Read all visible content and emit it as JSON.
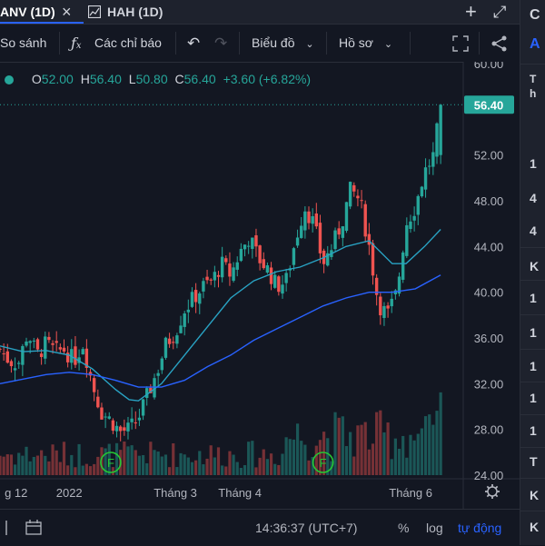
{
  "tabs": [
    {
      "label": "ANV (1D)",
      "active": true
    },
    {
      "label": "HAH (1D)",
      "active": false
    }
  ],
  "tab_icons": {
    "close": "×",
    "chart": "chart-tab-icon",
    "add": "+",
    "expand": "⤢"
  },
  "toolbar": {
    "compare": "So sánh",
    "indicators": "Các chỉ báo",
    "chart_type": "Biểu đồ",
    "profile": "Hồ sơ"
  },
  "legend": {
    "o_label": "O",
    "o": "52.00",
    "h_label": "H",
    "h": "56.40",
    "l_label": "L",
    "l": "50.80",
    "c_label": "C",
    "c": "56.40",
    "change": "+3.60 (+6.82%)"
  },
  "colors": {
    "up": "#26a69a",
    "down": "#ef5350",
    "ma_short": "#29a3c4",
    "ma_long": "#2962ff",
    "bg": "#131722",
    "price_label": "#26a69a"
  },
  "chart_data": {
    "type": "candlestick",
    "ylim": [
      24,
      60
    ],
    "y_ticks": [
      "60.00",
      "56.40",
      "52.00",
      "48.00",
      "44.00",
      "40.00",
      "36.00",
      "32.00",
      "28.00",
      "24.00"
    ],
    "y_tick_values": [
      60,
      52,
      48,
      44,
      40,
      36,
      32,
      28,
      24
    ],
    "last_price": 56.4,
    "last_price_label": "56.40",
    "x_labels": [
      {
        "label": "g 12",
        "t": 0.01
      },
      {
        "label": "2022",
        "t": 0.15
      },
      {
        "label": "Tháng 3",
        "t": 0.38
      },
      {
        "label": "Tháng 4",
        "t": 0.52
      },
      {
        "label": "Tháng 6",
        "t": 0.89
      }
    ],
    "markers": [
      {
        "label": "F",
        "t": 0.24
      },
      {
        "label": "F",
        "t": 0.7
      }
    ],
    "close_path": [
      [
        0.0,
        35.0
      ],
      [
        0.02,
        34.0
      ],
      [
        0.04,
        33.8
      ],
      [
        0.06,
        36.5
      ],
      [
        0.08,
        34.5
      ],
      [
        0.1,
        35.5
      ],
      [
        0.12,
        34.8
      ],
      [
        0.14,
        35.0
      ],
      [
        0.16,
        34.0
      ],
      [
        0.18,
        35.5
      ],
      [
        0.2,
        32.0
      ],
      [
        0.22,
        29.5
      ],
      [
        0.24,
        28.8
      ],
      [
        0.26,
        27.8
      ],
      [
        0.28,
        28.0
      ],
      [
        0.3,
        29.0
      ],
      [
        0.32,
        31.0
      ],
      [
        0.34,
        33.0
      ],
      [
        0.36,
        35.5
      ],
      [
        0.38,
        36.5
      ],
      [
        0.4,
        38.5
      ],
      [
        0.42,
        39.5
      ],
      [
        0.44,
        40.5
      ],
      [
        0.46,
        41.0
      ],
      [
        0.48,
        42.5
      ],
      [
        0.5,
        41.5
      ],
      [
        0.52,
        43.5
      ],
      [
        0.54,
        44.8
      ],
      [
        0.56,
        43.0
      ],
      [
        0.58,
        42.0
      ],
      [
        0.6,
        40.5
      ],
      [
        0.62,
        41.0
      ],
      [
        0.64,
        44.5
      ],
      [
        0.66,
        47.5
      ],
      [
        0.68,
        46.0
      ],
      [
        0.7,
        42.5
      ],
      [
        0.72,
        44.0
      ],
      [
        0.74,
        46.0
      ],
      [
        0.76,
        49.0
      ],
      [
        0.78,
        48.0
      ],
      [
        0.8,
        44.0
      ],
      [
        0.82,
        39.0
      ],
      [
        0.84,
        38.0
      ],
      [
        0.86,
        40.0
      ],
      [
        0.88,
        46.0
      ],
      [
        0.9,
        47.5
      ],
      [
        0.92,
        50.5
      ],
      [
        0.94,
        52.0
      ],
      [
        0.955,
        56.4
      ]
    ],
    "ma_short": [
      [
        0.0,
        35.3
      ],
      [
        0.05,
        34.8
      ],
      [
        0.1,
        34.9
      ],
      [
        0.15,
        34.5
      ],
      [
        0.2,
        33.3
      ],
      [
        0.25,
        31.5
      ],
      [
        0.28,
        30.6
      ],
      [
        0.3,
        30.5
      ],
      [
        0.35,
        32.0
      ],
      [
        0.4,
        34.5
      ],
      [
        0.45,
        37.0
      ],
      [
        0.5,
        39.5
      ],
      [
        0.55,
        41.0
      ],
      [
        0.6,
        41.8
      ],
      [
        0.65,
        42.2
      ],
      [
        0.7,
        43.0
      ],
      [
        0.75,
        44.0
      ],
      [
        0.8,
        44.5
      ],
      [
        0.85,
        42.5
      ],
      [
        0.88,
        42.5
      ],
      [
        0.92,
        44.0
      ],
      [
        0.955,
        45.5
      ]
    ],
    "ma_long": [
      [
        0.0,
        32.0
      ],
      [
        0.05,
        32.4
      ],
      [
        0.1,
        32.8
      ],
      [
        0.15,
        33.0
      ],
      [
        0.2,
        32.8
      ],
      [
        0.25,
        32.3
      ],
      [
        0.3,
        31.7
      ],
      [
        0.35,
        31.7
      ],
      [
        0.4,
        32.3
      ],
      [
        0.45,
        33.5
      ],
      [
        0.5,
        34.5
      ],
      [
        0.55,
        35.8
      ],
      [
        0.6,
        36.8
      ],
      [
        0.65,
        37.8
      ],
      [
        0.7,
        38.8
      ],
      [
        0.75,
        39.5
      ],
      [
        0.8,
        40.0
      ],
      [
        0.85,
        40.0
      ],
      [
        0.9,
        40.3
      ],
      [
        0.955,
        41.5
      ]
    ]
  },
  "right_panel": {
    "items": [
      "C",
      "A",
      "T",
      "h",
      "1",
      "4",
      "4",
      "K",
      "1",
      "1",
      "1",
      "1",
      "1",
      "T",
      "K",
      "K"
    ]
  },
  "bottom": {
    "time": "14:36:37 (UTC+7)",
    "percent": "%",
    "log": "log",
    "auto": "tự động"
  }
}
